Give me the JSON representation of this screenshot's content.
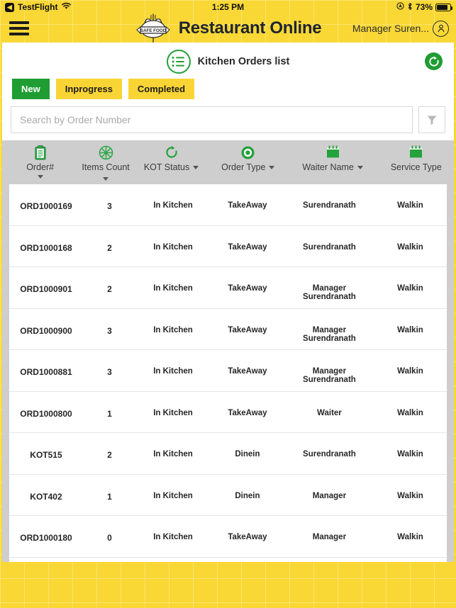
{
  "statusbar": {
    "back_glyph": "◀",
    "carrier_app": "TestFlight",
    "wifi_icon": "wifi-icon",
    "time": "1:25 PM",
    "location_icon": "location-icon",
    "bluetooth_icon": "bluetooth-icon",
    "battery_percent": "73%"
  },
  "appbar": {
    "menu_icon": "hamburger-menu-icon",
    "logo_icon": "safe-food-logo",
    "logo_text": "SAFE FOOD",
    "title": "Restaurant Online",
    "user_name": "Manager Suren...",
    "avatar_icon": "user-avatar-icon"
  },
  "page": {
    "list_icon": "list-lines-icon",
    "title": "Kitchen Orders list",
    "refresh_icon": "refresh-icon"
  },
  "tabs": [
    {
      "label": "New",
      "active": true
    },
    {
      "label": "Inprogress",
      "active": false
    },
    {
      "label": "Completed",
      "active": false
    }
  ],
  "search": {
    "value": "",
    "placeholder": "Search by Order Number",
    "filter_icon": "funnel-filter-icon"
  },
  "table": {
    "columns": [
      {
        "key": "order",
        "label": "Order#",
        "icon": "clipboard-icon",
        "sortable": true,
        "stacked": true
      },
      {
        "key": "count",
        "label": "Items Count",
        "icon": "pie-wheel-icon",
        "sortable": true,
        "stacked": true
      },
      {
        "key": "kot",
        "label": "KOT Status",
        "icon": "refresh-icon",
        "sortable": true,
        "stacked": false
      },
      {
        "key": "type",
        "label": "Order Type",
        "icon": "target-icon",
        "sortable": true,
        "stacked": false
      },
      {
        "key": "waiter",
        "label": "Waiter Name",
        "icon": "calendar-icon",
        "sortable": true,
        "stacked": false
      },
      {
        "key": "svc",
        "label": "Service Type",
        "icon": "calendar-icon",
        "sortable": false,
        "stacked": false
      }
    ],
    "rows": [
      {
        "order": "ORD1000169",
        "count": "3",
        "kot": "In Kitchen",
        "type": "TakeAway",
        "waiter": "Surendranath",
        "svc": "Walkin"
      },
      {
        "order": "ORD1000168",
        "count": "2",
        "kot": "In Kitchen",
        "type": "TakeAway",
        "waiter": "Surendranath",
        "svc": "Walkin"
      },
      {
        "order": "ORD1000901",
        "count": "2",
        "kot": "In Kitchen",
        "type": "TakeAway",
        "waiter": "Manager Surendranath",
        "svc": "Walkin"
      },
      {
        "order": "ORD1000900",
        "count": "3",
        "kot": "In Kitchen",
        "type": "TakeAway",
        "waiter": "Manager Surendranath",
        "svc": "Walkin"
      },
      {
        "order": "ORD1000881",
        "count": "3",
        "kot": "In Kitchen",
        "type": "TakeAway",
        "waiter": "Manager Surendranath",
        "svc": "Walkin"
      },
      {
        "order": "ORD1000800",
        "count": "1",
        "kot": "In Kitchen",
        "type": "TakeAway",
        "waiter": "Waiter",
        "svc": "Walkin"
      },
      {
        "order": "KOT515",
        "count": "2",
        "kot": "In Kitchen",
        "type": "Dinein",
        "waiter": "Surendranath",
        "svc": "Walkin"
      },
      {
        "order": "KOT402",
        "count": "1",
        "kot": "In Kitchen",
        "type": "Dinein",
        "waiter": "Manager",
        "svc": "Walkin"
      },
      {
        "order": "ORD1000180",
        "count": "0",
        "kot": "In Kitchen",
        "type": "TakeAway",
        "waiter": "Manager",
        "svc": "Walkin"
      }
    ]
  },
  "colors": {
    "brand_yellow": "#f9d835",
    "brand_green": "#1f9d33",
    "header_gray": "#cecece",
    "text_dark": "#262626"
  }
}
